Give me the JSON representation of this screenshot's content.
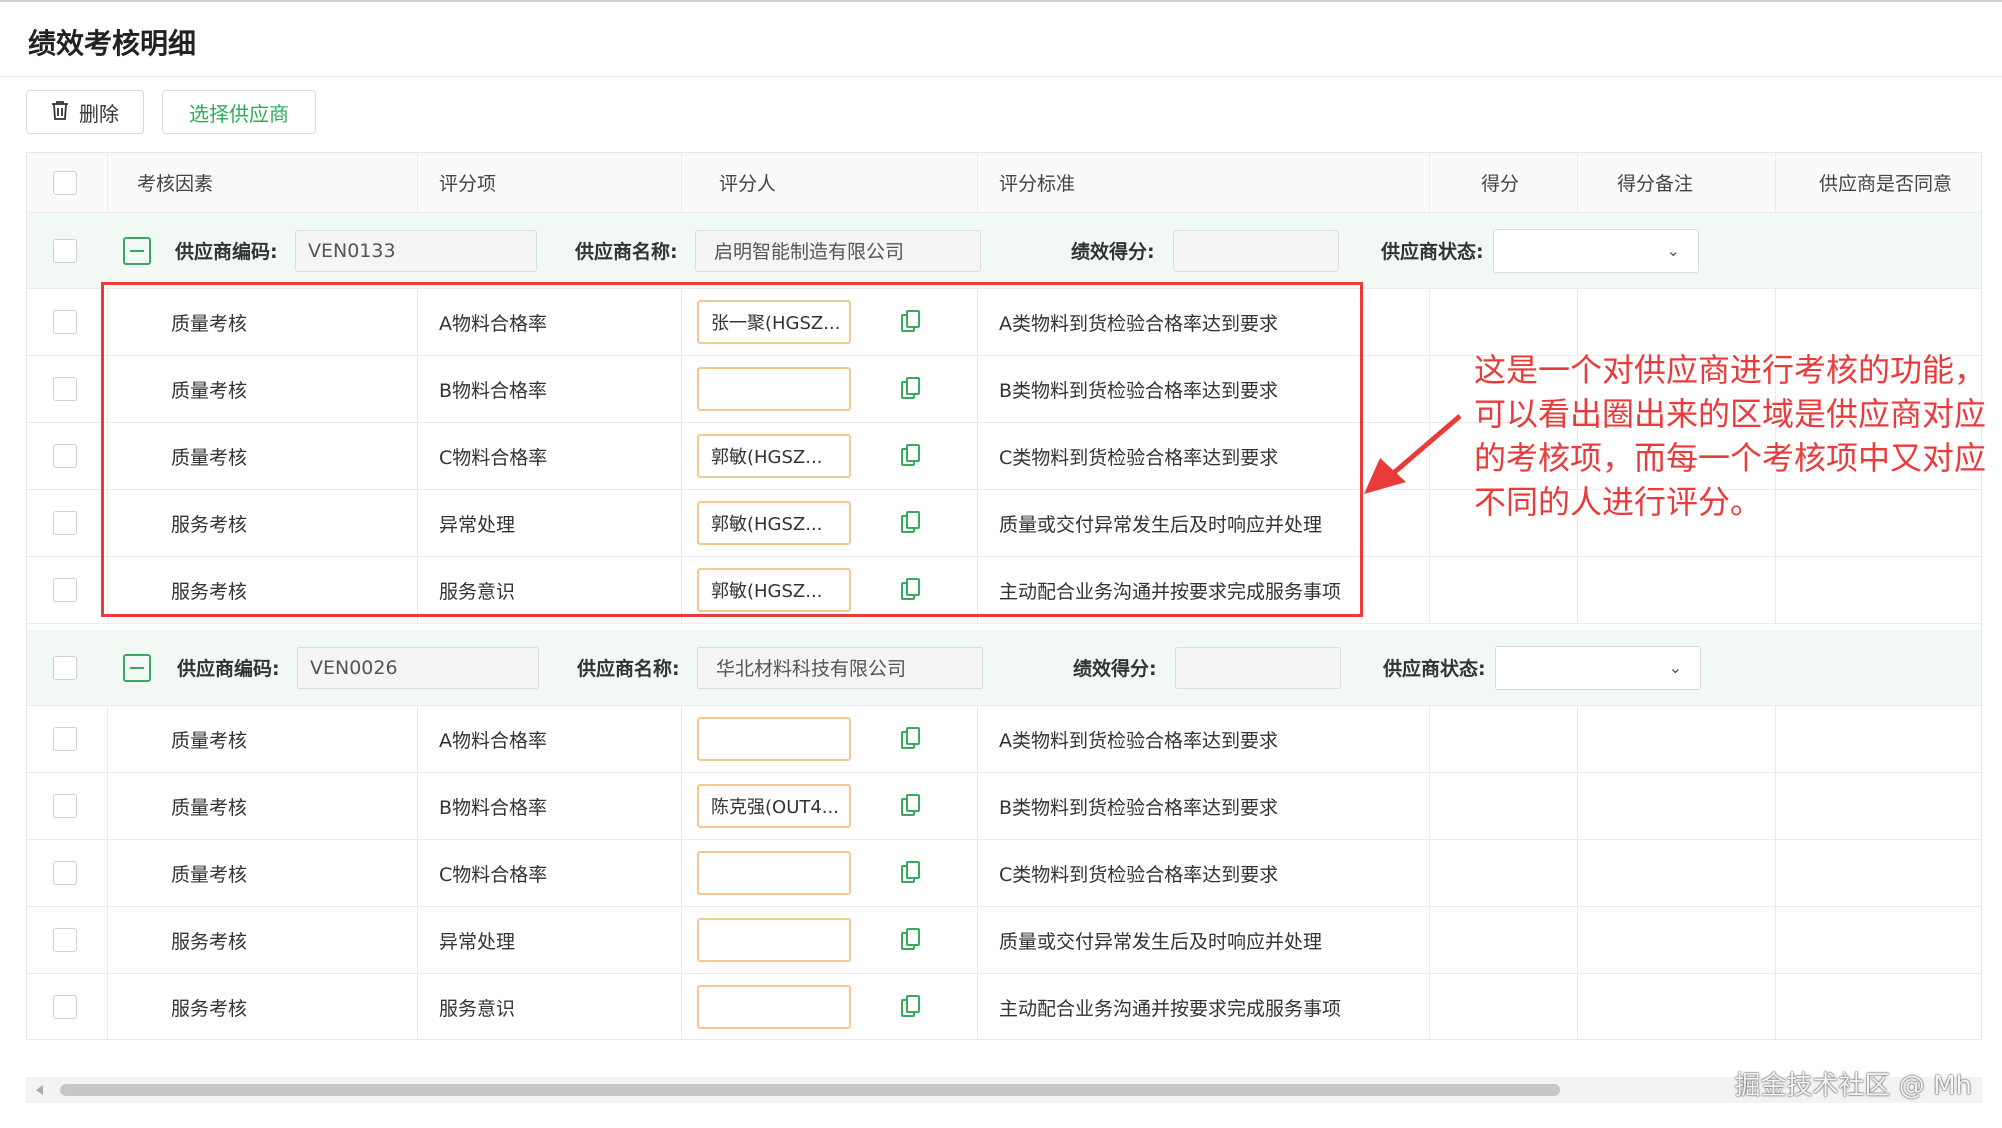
{
  "page": {
    "title": "绩效考核明细"
  },
  "toolbar": {
    "delete_label": "删除",
    "select_supplier_label": "选择供应商"
  },
  "columns": [
    "考核因素",
    "评分项",
    "评分人",
    "评分标准",
    "得分",
    "得分备注",
    "供应商是否同意"
  ],
  "group_labels": {
    "code": "供应商编码:",
    "name": "供应商名称:",
    "score": "绩效得分:",
    "status": "供应商状态:"
  },
  "groups": [
    {
      "code": "VEN0133",
      "name": "启明智能制造有限公司",
      "score": "",
      "status": "",
      "rows": [
        {
          "factor": "质量考核",
          "item": "A物料合格率",
          "rater": "张一聚(HGSZ...",
          "standard": "A类物料到货检验合格率达到要求"
        },
        {
          "factor": "质量考核",
          "item": "B物料合格率",
          "rater": "",
          "standard": "B类物料到货检验合格率达到要求"
        },
        {
          "factor": "质量考核",
          "item": "C物料合格率",
          "rater": "郭敏(HGSZ...",
          "standard": "C类物料到货检验合格率达到要求"
        },
        {
          "factor": "服务考核",
          "item": "异常处理",
          "rater": "郭敏(HGSZ...",
          "standard": "质量或交付异常发生后及时响应并处理"
        },
        {
          "factor": "服务考核",
          "item": "服务意识",
          "rater": "郭敏(HGSZ...",
          "standard": "主动配合业务沟通并按要求完成服务事项"
        }
      ]
    },
    {
      "code": "VEN0026",
      "name": "华北材料科技有限公司",
      "score": "",
      "status": "",
      "rows": [
        {
          "factor": "质量考核",
          "item": "A物料合格率",
          "rater": "",
          "standard": "A类物料到货检验合格率达到要求"
        },
        {
          "factor": "质量考核",
          "item": "B物料合格率",
          "rater": "陈克强(OUT4...",
          "standard": "B类物料到货检验合格率达到要求"
        },
        {
          "factor": "质量考核",
          "item": "C物料合格率",
          "rater": "",
          "standard": "C类物料到货检验合格率达到要求"
        },
        {
          "factor": "服务考核",
          "item": "异常处理",
          "rater": "",
          "standard": "质量或交付异常发生后及时响应并处理"
        },
        {
          "factor": "服务考核",
          "item": "服务意识",
          "rater": "",
          "standard": "主动配合业务沟通并按要求完成服务事项"
        }
      ]
    }
  ],
  "annotation": {
    "lines": [
      "这是一个对供应商进行考核的功能，",
      "可以看出圈出来的区域是供应商对应",
      "的考核项，而每一个考核项中又对应",
      "不同的人进行评分。"
    ]
  },
  "watermark": "掘金技术社区 @ Mh",
  "colors": {
    "accent": "#2eae5b",
    "highlight": "#ea3b3b",
    "input_border": "#f5c98e"
  }
}
